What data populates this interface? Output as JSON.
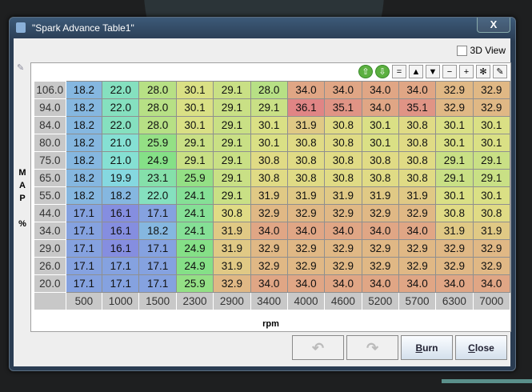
{
  "window": {
    "title": "\"Spark Advance Table1\"",
    "close_label": "X"
  },
  "view3d_label": "3D View",
  "toolbar": {
    "buttons": [
      {
        "name": "increase-green",
        "glyph": "⇧"
      },
      {
        "name": "decrease-green",
        "glyph": "⇩"
      },
      {
        "name": "set-equal",
        "glyph": "="
      },
      {
        "name": "raise",
        "glyph": "▲"
      },
      {
        "name": "lower",
        "glyph": "▼"
      },
      {
        "name": "minus",
        "glyph": "−"
      },
      {
        "name": "plus",
        "glyph": "+"
      },
      {
        "name": "multiply",
        "glyph": "✻"
      },
      {
        "name": "pen",
        "glyph": "✎"
      }
    ]
  },
  "y_axis": {
    "label": [
      "M",
      "A",
      "P",
      "",
      "%"
    ],
    "values": [
      "106.0",
      "94.0",
      "84.0",
      "80.0",
      "75.0",
      "65.0",
      "55.0",
      "44.0",
      "34.0",
      "29.0",
      "26.0",
      "20.0"
    ]
  },
  "x_axis": {
    "label": "rpm",
    "values": [
      "500",
      "1000",
      "1500",
      "2300",
      "2900",
      "3400",
      "4000",
      "4600",
      "5200",
      "5700",
      "6300",
      "7000"
    ]
  },
  "table": [
    [
      "18.2",
      "22.0",
      "28.0",
      "30.1",
      "29.1",
      "28.0",
      "34.0",
      "34.0",
      "34.0",
      "34.0",
      "32.9",
      "32.9"
    ],
    [
      "18.2",
      "22.0",
      "28.0",
      "30.1",
      "29.1",
      "29.1",
      "36.1",
      "35.1",
      "34.0",
      "35.1",
      "32.9",
      "32.9"
    ],
    [
      "18.2",
      "22.0",
      "28.0",
      "30.1",
      "29.1",
      "30.1",
      "31.9",
      "30.8",
      "30.1",
      "30.8",
      "30.1",
      "30.1"
    ],
    [
      "18.2",
      "21.0",
      "25.9",
      "29.1",
      "29.1",
      "30.1",
      "30.8",
      "30.8",
      "30.1",
      "30.8",
      "30.1",
      "30.1"
    ],
    [
      "18.2",
      "21.0",
      "24.9",
      "29.1",
      "29.1",
      "30.8",
      "30.8",
      "30.8",
      "30.8",
      "30.8",
      "29.1",
      "29.1"
    ],
    [
      "18.2",
      "19.9",
      "23.1",
      "25.9",
      "29.1",
      "30.8",
      "30.8",
      "30.8",
      "30.8",
      "30.8",
      "29.1",
      "29.1"
    ],
    [
      "18.2",
      "18.2",
      "22.0",
      "24.1",
      "29.1",
      "31.9",
      "31.9",
      "31.9",
      "31.9",
      "31.9",
      "30.1",
      "30.1"
    ],
    [
      "17.1",
      "16.1",
      "17.1",
      "24.1",
      "30.8",
      "32.9",
      "32.9",
      "32.9",
      "32.9",
      "32.9",
      "30.8",
      "30.8"
    ],
    [
      "17.1",
      "16.1",
      "18.2",
      "24.1",
      "31.9",
      "34.0",
      "34.0",
      "34.0",
      "34.0",
      "34.0",
      "31.9",
      "31.9"
    ],
    [
      "17.1",
      "16.1",
      "17.1",
      "24.9",
      "31.9",
      "32.9",
      "32.9",
      "32.9",
      "32.9",
      "32.9",
      "32.9",
      "32.9"
    ],
    [
      "17.1",
      "17.1",
      "17.1",
      "24.9",
      "31.9",
      "32.9",
      "32.9",
      "32.9",
      "32.9",
      "32.9",
      "32.9",
      "32.9"
    ],
    [
      "17.1",
      "17.1",
      "17.1",
      "25.9",
      "32.9",
      "34.0",
      "34.0",
      "34.0",
      "34.0",
      "34.0",
      "34.0",
      "34.0"
    ]
  ],
  "buttons": {
    "undo": "↶",
    "redo": "↷",
    "burn_u": "B",
    "burn_rest": "urn",
    "close_u": "C",
    "close_rest": "lose"
  }
}
